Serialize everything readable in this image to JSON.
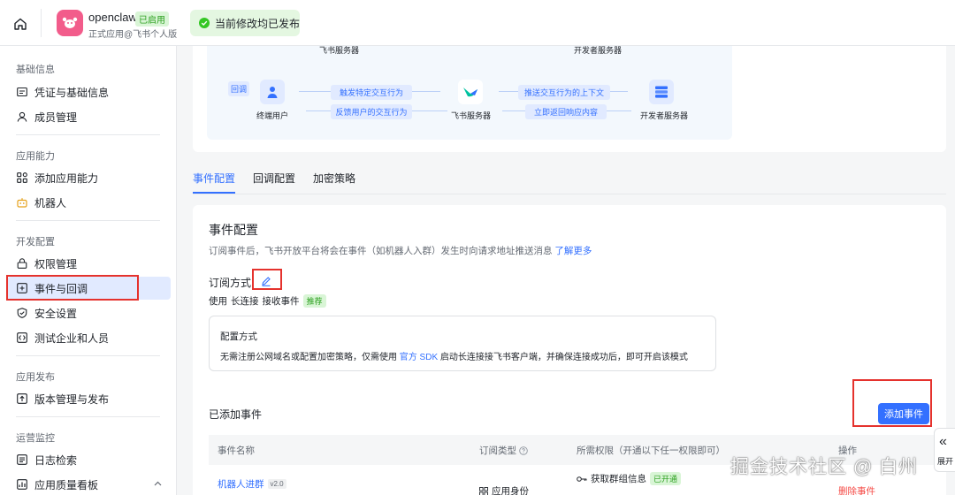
{
  "header": {
    "app_name": "openclaw",
    "app_status": "已启用",
    "app_subtitle": "正式应用@飞书个人版",
    "toast": "当前修改均已发布"
  },
  "sidebar": {
    "sections": [
      {
        "title": "基础信息",
        "items": [
          {
            "label": "凭证与基础信息",
            "icon": "credential-icon"
          },
          {
            "label": "成员管理",
            "icon": "user-icon"
          }
        ]
      },
      {
        "title": "应用能力",
        "items": [
          {
            "label": "添加应用能力",
            "icon": "grid-add-icon"
          },
          {
            "label": "机器人",
            "icon": "robot-icon"
          }
        ]
      },
      {
        "title": "开发配置",
        "items": [
          {
            "label": "权限管理",
            "icon": "lock-icon"
          },
          {
            "label": "事件与回调",
            "icon": "event-icon",
            "active": true
          },
          {
            "label": "安全设置",
            "icon": "shield-icon"
          },
          {
            "label": "测试企业和人员",
            "icon": "test-icon"
          }
        ]
      },
      {
        "title": "应用发布",
        "items": [
          {
            "label": "版本管理与发布",
            "icon": "upload-icon"
          }
        ]
      },
      {
        "title": "运营监控",
        "items": [
          {
            "label": "日志检索",
            "icon": "log-icon"
          },
          {
            "label": "应用质量看板",
            "icon": "dashboard-icon"
          }
        ]
      }
    ]
  },
  "flow": {
    "top_left_server": "飞书服务器",
    "top_right_server": "开发者服务器",
    "callback_tag": "回调",
    "end_user": "终端用户",
    "feishu_server": "飞书服务器",
    "dev_server": "开发者服务器",
    "pill_trigger": "触发特定交互行为",
    "pill_feedback": "反馈用户的交互行为",
    "pill_push": "推送交互行为的上下文",
    "pill_return": "立即返回响应内容"
  },
  "tabs": [
    "事件配置",
    "回调配置",
    "加密策略"
  ],
  "event_config": {
    "title": "事件配置",
    "desc": "订阅事件后，飞书开放平台将会在事件（如机器人入群）发生时向请求地址推送消息",
    "learn_more": "了解更多",
    "subscribe_label": "订阅方式",
    "use_prefix": "使用",
    "use_mode": "长连接",
    "use_suffix": "接收事件",
    "recommend": "推荐",
    "config_title": "配置方式",
    "config_desc_1": "无需注册公网域名或配置加密策略，仅需使用",
    "config_sdk": "官方 SDK",
    "config_desc_2": "启动长连接接飞书客户端，并确保连接成功后，即可开启该模式",
    "added_title": "已添加事件",
    "add_button": "添加事件"
  },
  "table": {
    "columns": [
      "事件名称",
      "订阅类型",
      "所需权限（开通以下任一权限即可）",
      "操作"
    ],
    "rows": [
      {
        "name": "机器人进群",
        "version": "v2.0",
        "type": "应用身份",
        "permission": "获取群组信息",
        "perm_status": "已开通",
        "action": "删除事件"
      }
    ]
  },
  "collapse": {
    "label": "展开"
  },
  "watermark": "掘金技术社区 @ 白州"
}
